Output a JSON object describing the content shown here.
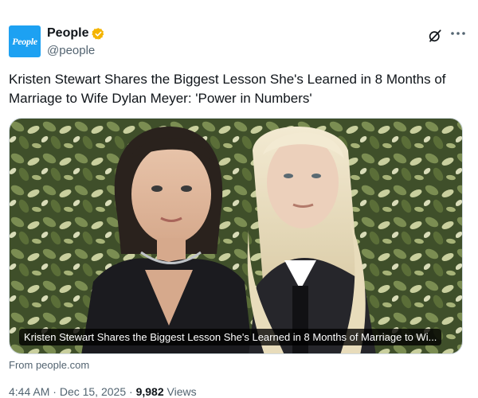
{
  "author": {
    "display_name": "People",
    "handle": "@people",
    "avatar_text": "People",
    "verified_color": "#f4b400"
  },
  "tweet": {
    "text": "Kristen Stewart Shares the Biggest Lesson She's Learned in 8 Months of Marriage to Wife Dylan Meyer: 'Power in Numbers'"
  },
  "card": {
    "caption": "Kristen Stewart Shares the Biggest Lesson She's Learned in 8 Months of Marriage to Wi...",
    "source": "From people.com"
  },
  "meta": {
    "time": "4:44 AM",
    "date": "Dec 15, 2025",
    "views_count": "9,982",
    "views_label": "Views",
    "separator": "·"
  },
  "icons": {
    "grok": "grok-icon",
    "more": "more-icon",
    "verified": "verified-badge-icon"
  },
  "colors": {
    "text_primary": "#0f1419",
    "text_secondary": "#536471",
    "avatar_bg": "#1da1f2",
    "border": "#cfd9de"
  }
}
